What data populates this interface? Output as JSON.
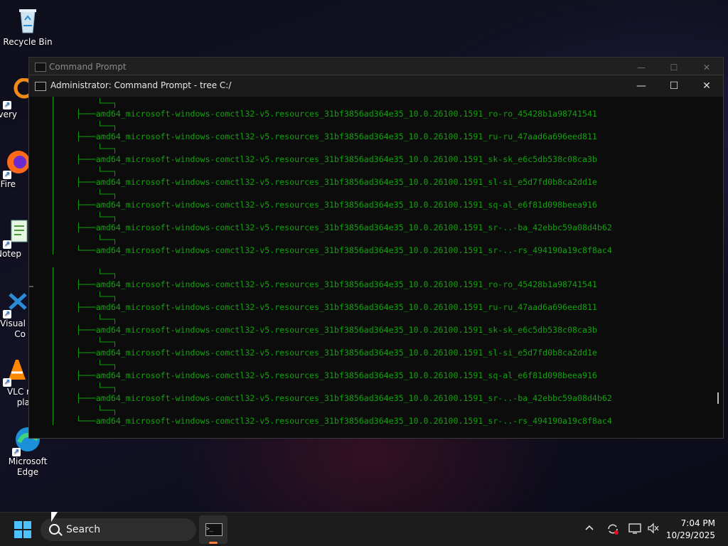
{
  "desktop": {
    "icons": [
      {
        "label": "Recycle Bin",
        "icon": "recycle-bin-icon"
      },
      {
        "label": "Every",
        "icon": "everything-icon"
      },
      {
        "label": "Fire",
        "icon": "firefox-icon"
      },
      {
        "label": "Notep",
        "icon": "notepad-icon"
      },
      {
        "label": "Visual\nCo",
        "icon": "vscode-icon"
      },
      {
        "label": "VLC r\npla",
        "icon": "vlc-icon"
      },
      {
        "label": "Microsoft\nEdge",
        "icon": "edge-icon"
      }
    ]
  },
  "back_window": {
    "title": "Command Prompt"
  },
  "window": {
    "title": "Administrator: Command Prompt - tree  C:/",
    "controls": {
      "minimize": "—",
      "maximize": "☐",
      "close": "✕"
    }
  },
  "console": {
    "prefix": "├───",
    "last_prefix": "└───",
    "branch": "└──┐",
    "entries_a": [
      "amd64_microsoft-windows-comctl32-v5.resources_31bf3856ad364e35_10.0.26100.1591_ro-ro_45428b1a98741541",
      "amd64_microsoft-windows-comctl32-v5.resources_31bf3856ad364e35_10.0.26100.1591_ru-ru_47aad6a696eed811",
      "amd64_microsoft-windows-comctl32-v5.resources_31bf3856ad364e35_10.0.26100.1591_sk-sk_e6c5db538c08ca3b",
      "amd64_microsoft-windows-comctl32-v5.resources_31bf3856ad364e35_10.0.26100.1591_sl-si_e5d7fd0b8ca2dd1e",
      "amd64_microsoft-windows-comctl32-v5.resources_31bf3856ad364e35_10.0.26100.1591_sq-al_e6f81d098beea916",
      "amd64_microsoft-windows-comctl32-v5.resources_31bf3856ad364e35_10.0.26100.1591_sr-..-ba_42ebbc59a08d4b62",
      "amd64_microsoft-windows-comctl32-v5.resources_31bf3856ad364e35_10.0.26100.1591_sr-..-rs_494190a19c8f8ac4"
    ],
    "entries_b": [
      "amd64_microsoft-windows-comctl32-v5.resources_31bf3856ad364e35_10.0.26100.1591_ro-ro_45428b1a98741541",
      "amd64_microsoft-windows-comctl32-v5.resources_31bf3856ad364e35_10.0.26100.1591_ru-ru_47aad6a696eed811",
      "amd64_microsoft-windows-comctl32-v5.resources_31bf3856ad364e35_10.0.26100.1591_sk-sk_e6c5db538c08ca3b",
      "amd64_microsoft-windows-comctl32-v5.resources_31bf3856ad364e35_10.0.26100.1591_sl-si_e5d7fd0b8ca2dd1e",
      "amd64_microsoft-windows-comctl32-v5.resources_31bf3856ad364e35_10.0.26100.1591_sq-al_e6f81d098beea916",
      "amd64_microsoft-windows-comctl32-v5.resources_31bf3856ad364e35_10.0.26100.1591_sr-..-ba_42ebbc59a08d4b62",
      "amd64_microsoft-windows-comctl32-v5.resources_31bf3856ad364e35_10.0.26100.1591_sr-..-rs_494190a19c8f8ac4"
    ],
    "text_color": "#13a10e"
  },
  "taskbar": {
    "search_placeholder": "Search",
    "clock_time": "7:04 PM",
    "clock_date": "10/29/2025",
    "tray_icons": [
      "chevron-up-icon",
      "sync-icon",
      "network-icon",
      "volume-muted-icon"
    ],
    "accent": "#4cc2ff"
  }
}
